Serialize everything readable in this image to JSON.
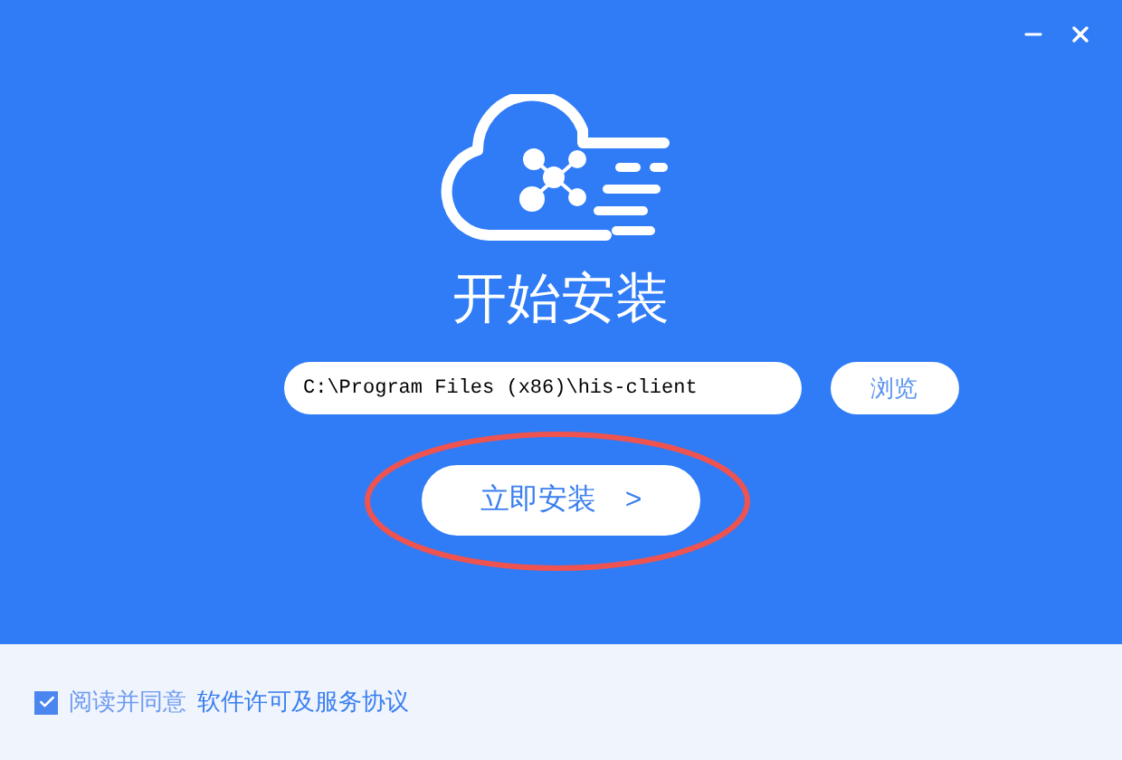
{
  "title": "开始安装",
  "install_path": {
    "value": "C:\\Program Files (x86)\\his-client"
  },
  "browse_button": "浏览",
  "install_button": {
    "label": "立即安装",
    "arrow": ">"
  },
  "agreement": {
    "checked": true,
    "text": "阅读并同意",
    "link": "软件许可及服务协议"
  }
}
